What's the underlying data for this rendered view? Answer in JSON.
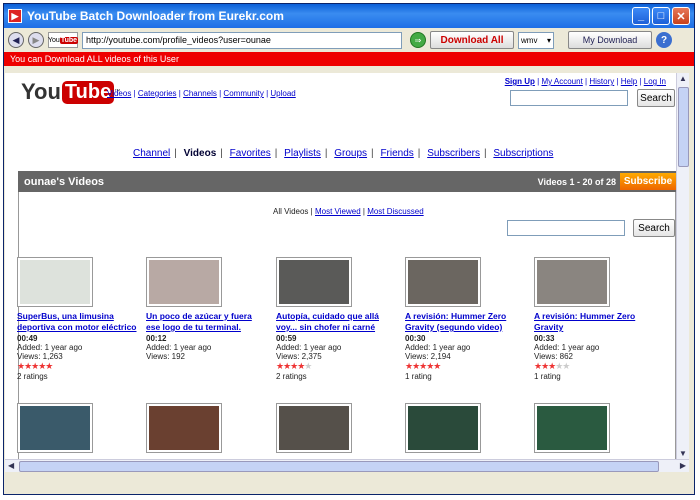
{
  "window": {
    "title": "YouTube Batch Downloader from Eurekr.com"
  },
  "toolbar": {
    "url": "http://youtube.com/profile_videos?user=ounae",
    "download_all_label": "Download All",
    "format": "wmv",
    "my_download_label": "My Download",
    "help_glyph": "?",
    "yt_mini_you": "You",
    "yt_mini_tube": "Tube"
  },
  "notice": "You can Download ALL videos of this User",
  "site": {
    "logo_you": "You",
    "logo_tube": "Tube",
    "logo_tm": "™",
    "top_links": [
      "Videos",
      "Categories",
      "Channels",
      "Community",
      "Upload"
    ],
    "user_links": [
      "Sign Up",
      "My Account",
      "History",
      "Help",
      "Log In"
    ],
    "search_label": "Search"
  },
  "channel_nav": [
    "Channel",
    "Videos",
    "Favorites",
    "Playlists",
    "Groups",
    "Friends",
    "Subscribers",
    "Subscriptions"
  ],
  "videos_header": {
    "title": "ounae's Videos",
    "count": "Videos 1 - 20 of 28",
    "subscribe_label": "Subscribe"
  },
  "filters": {
    "all": "All Videos",
    "most_viewed": "Most Viewed",
    "most_discussed": "Most Discussed",
    "sep": "|"
  },
  "search2_label": "Search",
  "videos": [
    {
      "title": "SuperBus, una limusina deportiva con motor eléctrico",
      "duration": "00:49",
      "added": "Added: 1 year ago",
      "views": "Views: 1,263",
      "stars": 5,
      "ratings": "2 ratings",
      "thumb_color": "#dde2dc"
    },
    {
      "title": "Un poco de azúcar y fuera ese logo de tu terminal.",
      "duration": "00:12",
      "added": "Added: 1 year ago",
      "views": "Views: 192",
      "stars": 0,
      "ratings": "",
      "thumb_color": "#b8a9a4"
    },
    {
      "title": "Autopía, cuidado que allá voy... sin chofer ni carné",
      "duration": "00:59",
      "added": "Added: 1 year ago",
      "views": "Views: 2,375",
      "stars": 4,
      "ratings": "2 ratings",
      "thumb_color": "#5a5a58"
    },
    {
      "title": "A revisión: Hummer Zero Gravity (segundo video)",
      "duration": "00:30",
      "added": "Added: 1 year ago",
      "views": "Views: 2,194",
      "stars": 5,
      "ratings": "1 rating",
      "thumb_color": "#6b6660"
    },
    {
      "title": "A revisión: Hummer Zero Gravity",
      "duration": "00:33",
      "added": "Added: 1 year ago",
      "views": "Views: 862",
      "stars": 3,
      "ratings": "1 rating",
      "thumb_color": "#8a8580"
    }
  ],
  "videos_row2_colors": [
    "#3a5a6a",
    "#6a4030",
    "#55504a",
    "#2a4a3a",
    "#2a5a40"
  ],
  "colors": {
    "notice_bar": "#ee0000",
    "subscribe": "#ff9900",
    "link": "#0000cc",
    "star": "#ee3333"
  }
}
